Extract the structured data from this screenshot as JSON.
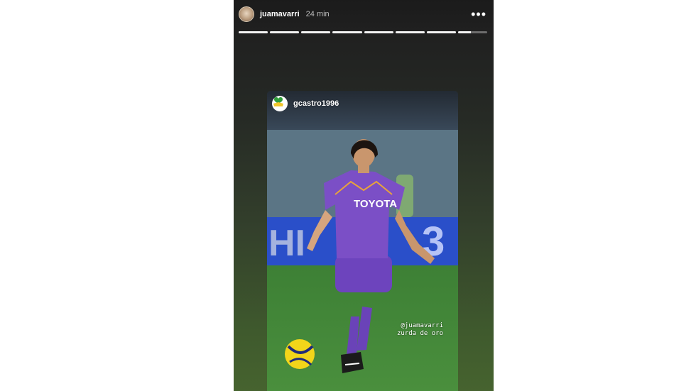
{
  "story": {
    "username": "juamavarri",
    "time_ago": "24 min",
    "more_icon": "more-horizontal-icon",
    "segments_total": 8,
    "segments_viewed": 7,
    "current_segment_progress": 0.45
  },
  "shared_post": {
    "username": "gcastro1996",
    "avatar_icon": "club-crest-icon",
    "jersey_text": "TOYOTA",
    "caption_lines": [
      "@juamavarri",
      "zurda de oro"
    ]
  },
  "colors": {
    "jersey": "#7b4fc6",
    "pitch": "#3f8a3a",
    "story_bg_bottom": "#46632f"
  }
}
